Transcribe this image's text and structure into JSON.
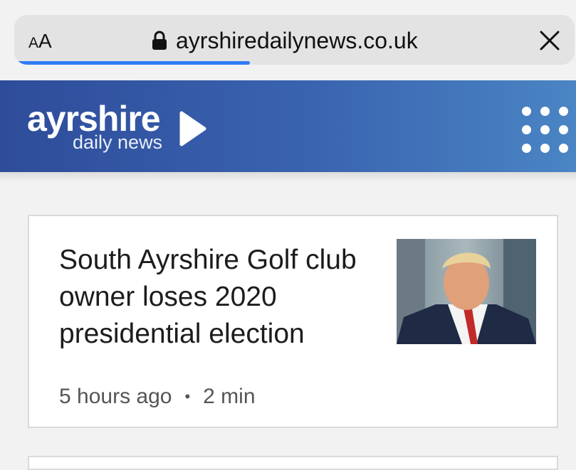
{
  "browser": {
    "text_size_small": "A",
    "text_size_large": "A",
    "url": "ayrshiredailynews.co.uk",
    "lock_icon": "lock-icon",
    "close_icon": "close-icon",
    "progress": 0.42,
    "accent_color": "#2f7cf6"
  },
  "site": {
    "logo_top": "ayrshire",
    "logo_bottom": "daily news",
    "menu_icon": "grid-dots-icon",
    "header_colors": [
      "#2e4c9a",
      "#4a85c4"
    ]
  },
  "article": {
    "headline": "South Ayrshire Golf club owner loses 2020 presidential election",
    "time": "5 hours ago",
    "separator": "•",
    "read_time": "2 min",
    "thumbnail": "news-photo"
  }
}
